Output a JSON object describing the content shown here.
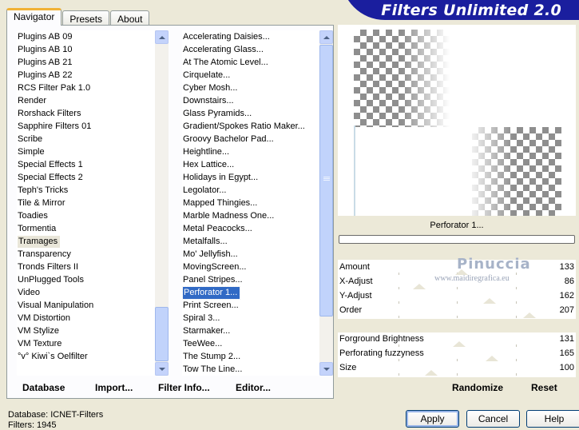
{
  "tabs": [
    "Navigator",
    "Presets",
    "About"
  ],
  "title": "Filters Unlimited 2.0",
  "categories": {
    "items": [
      "Plugins AB 09",
      "Plugins AB 10",
      "Plugins AB 21",
      "Plugins AB 22",
      "RCS Filter Pak 1.0",
      "Render",
      "Rorshack Filters",
      "Sapphire Filters 01",
      "Scribe",
      "Simple",
      "Special Effects 1",
      "Special Effects 2",
      "Teph's Tricks",
      "Tile & Mirror",
      "Toadies",
      "Tormentia",
      "Tramages",
      "Transparency",
      "Tronds Filters II",
      "UnPlugged Tools",
      "Video",
      "Visual Manipulation",
      "VM Distortion",
      "VM Stylize",
      "VM Texture",
      "°v° Kiwi`s Oelfilter"
    ],
    "selected": "Tramages"
  },
  "filters": {
    "items": [
      "Accelerating Daisies...",
      "Accelerating Glass...",
      "At The Atomic Level...",
      "Cirquelate...",
      "Cyber Mosh...",
      "Downstairs...",
      "Glass Pyramids...",
      "Gradient/Spokes Ratio Maker...",
      "Groovy Bachelor Pad...",
      "Heightline...",
      "Hex Lattice...",
      "Holidays in Egypt...",
      "Legolator...",
      "Mapped Thingies...",
      "Marble Madness One...",
      "Metal Peacocks...",
      "Metalfalls...",
      "Mo' Jellyfish...",
      "MovingScreen...",
      "Panel Stripes...",
      "Perforator 1...",
      "Print Screen...",
      "Spiral 3...",
      "Starmaker...",
      "TeeWee...",
      "The Stump 2...",
      "Tow The Line..."
    ],
    "selected": "Perforator 1..."
  },
  "buttons": {
    "database": "Database",
    "import": "Import...",
    "filter_info": "Filter Info...",
    "editor": "Editor...",
    "randomize": "Randomize",
    "reset": "Reset",
    "apply": "Apply",
    "cancel": "Cancel",
    "help": "Help"
  },
  "preview": {
    "filter_name": "Perforator 1..."
  },
  "sliders": [
    {
      "label": "Amount",
      "value": "133",
      "level": 0.52
    },
    {
      "label": "X-Adjust",
      "value": "86",
      "level": 0.34
    },
    {
      "label": "Y-Adjust",
      "value": "162",
      "level": 0.64
    },
    {
      "label": "Order",
      "value": "207",
      "level": 0.81
    },
    {
      "label": "",
      "value": "",
      "level": null
    },
    {
      "label": "Forground Brightness",
      "value": "131",
      "level": 0.51
    },
    {
      "label": "Perforating fuzzyness",
      "value": "165",
      "level": 0.65
    },
    {
      "label": "Size",
      "value": "100",
      "level": 0.39
    }
  ],
  "watermark": {
    "name": "Pinuccia",
    "url": "www.maidiregrafica.eu"
  },
  "status": {
    "line1": "Database:   ICNET-Filters",
    "line2": "Filters:      1945"
  },
  "colors": {
    "banner": "#1a1e9e",
    "selection": "#316ac5",
    "tab_accent": "#f1b236"
  }
}
